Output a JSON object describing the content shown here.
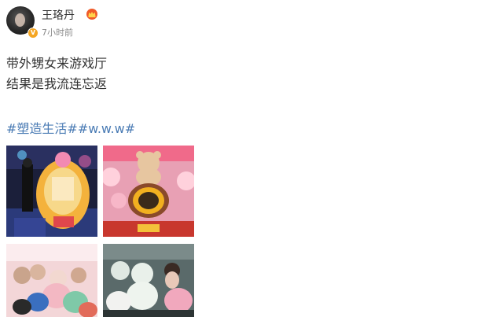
{
  "post": {
    "author": "王珞丹",
    "timestamp": "7小时前",
    "lines": [
      "带外甥女来游戏厅",
      "结果是我流连忘返"
    ],
    "hashtags": "#塑造生活##w.w.w#"
  },
  "icons": {
    "avatar": "avatar-photo",
    "verified": "verified-v-badge",
    "vip": "crown-badge"
  },
  "colors": {
    "text": "#333333",
    "meta": "#8a8a8a",
    "link": "#4a7bb4",
    "badge": "#f5a623"
  }
}
